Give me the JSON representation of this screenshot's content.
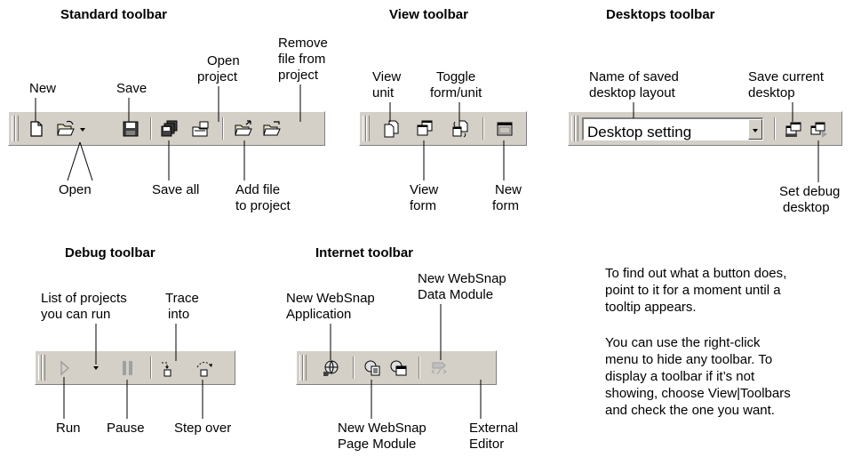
{
  "sections": {
    "standard": {
      "title": "Standard toolbar",
      "labels": {
        "new": "New",
        "save": "Save",
        "open_project_1": "Open",
        "open_project_2": "project",
        "remove_1": "Remove",
        "remove_2": "file from",
        "remove_3": "project",
        "open": "Open",
        "save_all": "Save all",
        "add_1": "Add file",
        "add_2": "to project"
      }
    },
    "view": {
      "title": "View toolbar",
      "labels": {
        "view_unit_1": "View",
        "view_unit_2": "unit",
        "toggle_1": "Toggle",
        "toggle_2": "form/unit",
        "view_form_1": "View",
        "view_form_2": "form",
        "new_form_1": "New",
        "new_form_2": "form"
      }
    },
    "desktops": {
      "title": "Desktops toolbar",
      "combo_value": "Desktop setting",
      "labels": {
        "name_1": "Name of saved",
        "name_2": "desktop layout",
        "save_current_1": "Save current",
        "save_current_2": "desktop",
        "set_debug_1": "Set debug",
        "set_debug_2": "desktop"
      }
    },
    "debug": {
      "title": "Debug toolbar",
      "labels": {
        "list_1": "List of projects",
        "list_2": "you can run",
        "trace_1": "Trace",
        "trace_2": "into",
        "run": "Run",
        "pause": "Pause",
        "step_over": "Step over"
      }
    },
    "internet": {
      "title": "Internet toolbar",
      "labels": {
        "app_1": "New WebSnap",
        "app_2": "Application",
        "data_1": "New WebSnap",
        "data_2": "Data Module",
        "page_1": "New WebSnap",
        "page_2": "Page Module",
        "editor_1": "External",
        "editor_2": "Editor"
      }
    }
  },
  "notes": {
    "p1_1": "To find out what a button does,",
    "p1_2": "point to it for a moment until a",
    "p1_3": "tooltip appears.",
    "p2_1": "You can use the right-click",
    "p2_2": "menu to hide any toolbar. To",
    "p2_3": "display a toolbar if it’s not",
    "p2_4": "showing, choose View|Toolbars",
    "p2_5": "and check the one you want."
  },
  "colors": {
    "toolbar_face": "#d4d0c8",
    "shadow": "#808080",
    "disabled": "#a0a0a0"
  }
}
